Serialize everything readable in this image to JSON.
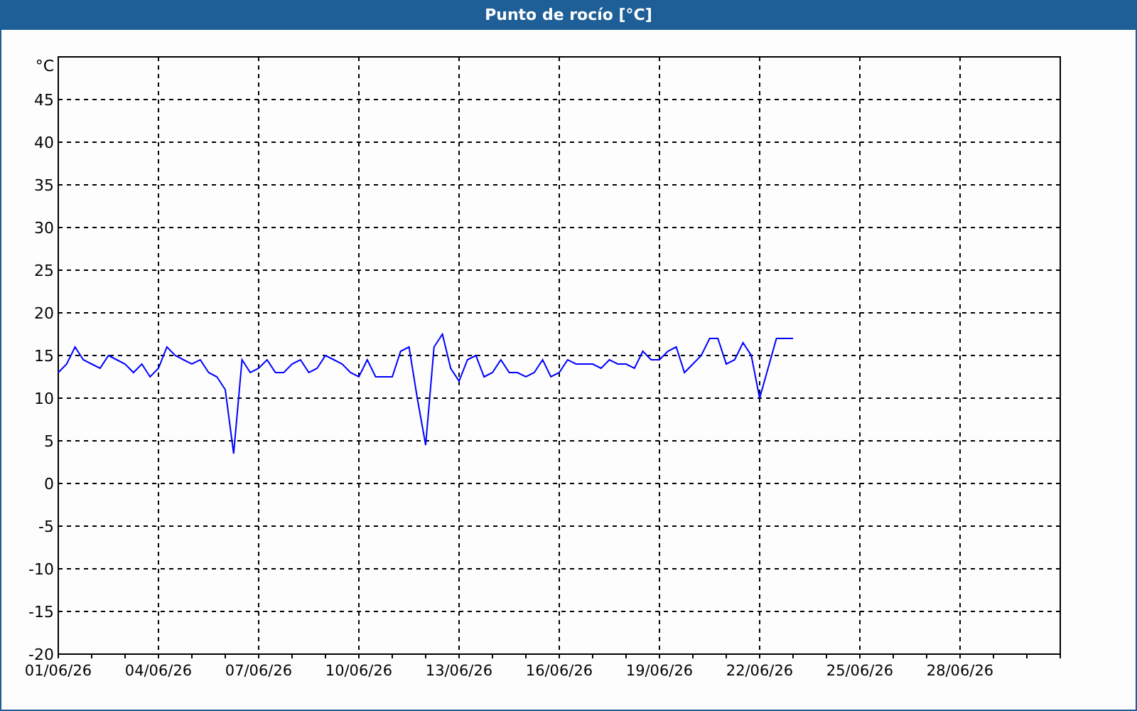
{
  "chart": {
    "chart_data": {
      "type": "line",
      "grid": true,
      "title": "Punto de rocío [°C]",
      "ylabel": "°C",
      "ylim": [
        -20,
        50
      ],
      "categories": [
        "01/06/26",
        null,
        null,
        null,
        null,
        null,
        null,
        null,
        null,
        null,
        null,
        null,
        "04/06/26",
        null,
        null,
        null,
        null,
        null,
        null,
        null,
        null,
        null,
        null,
        null,
        "07/06/26",
        null,
        null,
        null,
        null,
        null,
        null,
        null,
        null,
        null,
        null,
        null,
        "10/06/26",
        null,
        null,
        null,
        null,
        null,
        null,
        null,
        null,
        null,
        null,
        null,
        "13/06/26",
        null,
        null,
        null,
        null,
        null,
        null,
        null,
        null,
        null,
        null,
        null,
        "16/06/26",
        null,
        null,
        null,
        null,
        null,
        null,
        null,
        null,
        null,
        null,
        null,
        "19/06/26",
        null,
        null,
        null,
        null,
        null,
        null,
        null,
        null,
        null,
        null,
        null,
        "22/06/26",
        null,
        null,
        null,
        null,
        null,
        null,
        null,
        null,
        null,
        null,
        null,
        "25/06/26",
        null,
        null,
        null,
        null,
        null,
        null,
        null,
        null,
        null,
        null,
        null,
        "28/06/26",
        null,
        null,
        null,
        null,
        null,
        null,
        null,
        null,
        null,
        null,
        null,
        null
      ],
      "yticks": [
        -20,
        -15,
        -10,
        -5,
        0,
        5,
        10,
        15,
        20,
        25,
        30,
        35,
        40,
        45
      ],
      "series": [
        {
          "color": "#0000ff",
          "values": [
            13,
            14,
            16,
            14.5,
            14,
            13.5,
            15,
            14.5,
            14,
            13,
            14,
            12.5,
            13.5,
            16,
            15,
            14.5,
            14,
            14.5,
            13,
            12.5,
            11,
            3.5,
            14.5,
            13,
            13.5,
            14.5,
            13,
            13,
            14,
            14.5,
            13,
            13.5,
            15,
            14.5,
            14,
            13,
            12.5,
            14.5,
            12.5,
            12.5,
            12.5,
            15.5,
            16,
            10,
            4.5,
            16,
            17.5,
            13.5,
            12,
            14.5,
            15,
            12.5,
            13,
            14.5,
            13,
            13,
            12.5,
            13,
            14.5,
            12.5,
            13,
            14.5,
            14,
            14,
            14,
            13.5,
            14.5,
            14,
            14,
            13.5,
            15.5,
            14.5,
            14.5,
            15.5,
            16,
            13,
            14,
            15,
            17,
            17,
            14,
            14.5,
            16.5,
            15,
            10,
            13.5,
            17,
            17,
            17,
            null,
            null,
            null,
            null,
            null,
            null,
            null,
            null,
            null,
            null,
            null,
            null,
            null,
            null,
            null,
            null,
            null,
            null,
            null,
            null,
            null,
            null,
            null,
            null,
            null,
            null,
            null,
            null,
            null,
            null,
            null,
            null
          ]
        }
      ]
    }
  }
}
